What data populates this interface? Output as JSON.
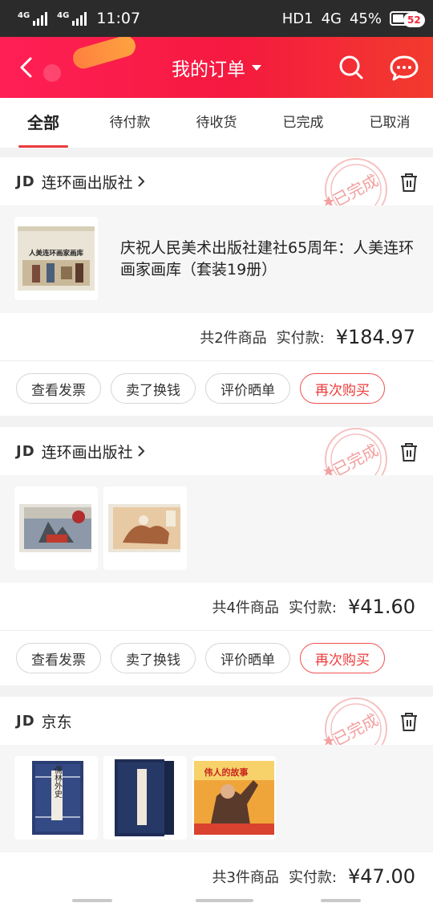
{
  "status_bar": {
    "signal1_label": "4G",
    "signal2_label": "4G",
    "time": "11:07",
    "hd_label": "HD1",
    "network": "4G",
    "battery_text": "45%",
    "battery_level": 0.45
  },
  "header": {
    "title": "我的订单",
    "message_badge": "52",
    "icons": {
      "back": "back-arrow-icon",
      "search": "search-icon",
      "messages": "chat-bubble-icon"
    }
  },
  "tabs": [
    {
      "label": "全部",
      "active": true
    },
    {
      "label": "待付款",
      "active": false
    },
    {
      "label": "待收货",
      "active": false
    },
    {
      "label": "已完成",
      "active": false
    },
    {
      "label": "已取消",
      "active": false
    }
  ],
  "orders": [
    {
      "shop_logo": "JD",
      "shop_name": "连环画出版社",
      "status_stamp": "已完成",
      "goods_title": "庆祝人民美术出版社建社65周年：人美连环画家画库（套装19册）",
      "thumb_captions": [
        "人美连环画家画库"
      ],
      "count_text": "共2件商品",
      "paid_label": "实付款:",
      "amount": "¥184.97",
      "buttons": [
        "查看发票",
        "卖了换钱",
        "评价晒单",
        "再次购买"
      ]
    },
    {
      "shop_logo": "JD",
      "shop_name": "连环画出版社",
      "status_stamp": "已完成",
      "count_text": "共4件商品",
      "paid_label": "实付款:",
      "amount": "¥41.60",
      "buttons": [
        "查看发票",
        "卖了换钱",
        "评价晒单",
        "再次购买"
      ]
    },
    {
      "shop_logo": "JD",
      "shop_name": "京东",
      "status_stamp": "已完成",
      "thumb_captions": [
        "儒林外史",
        "伟人的故事"
      ],
      "count_text": "共3件商品",
      "paid_label": "实付款:",
      "amount": "¥47.00"
    }
  ],
  "colors": {
    "header_start": "#ff1f55",
    "header_end": "#f23b2d",
    "accent": "#e93b3d",
    "stamp": "#f2a0a0"
  }
}
